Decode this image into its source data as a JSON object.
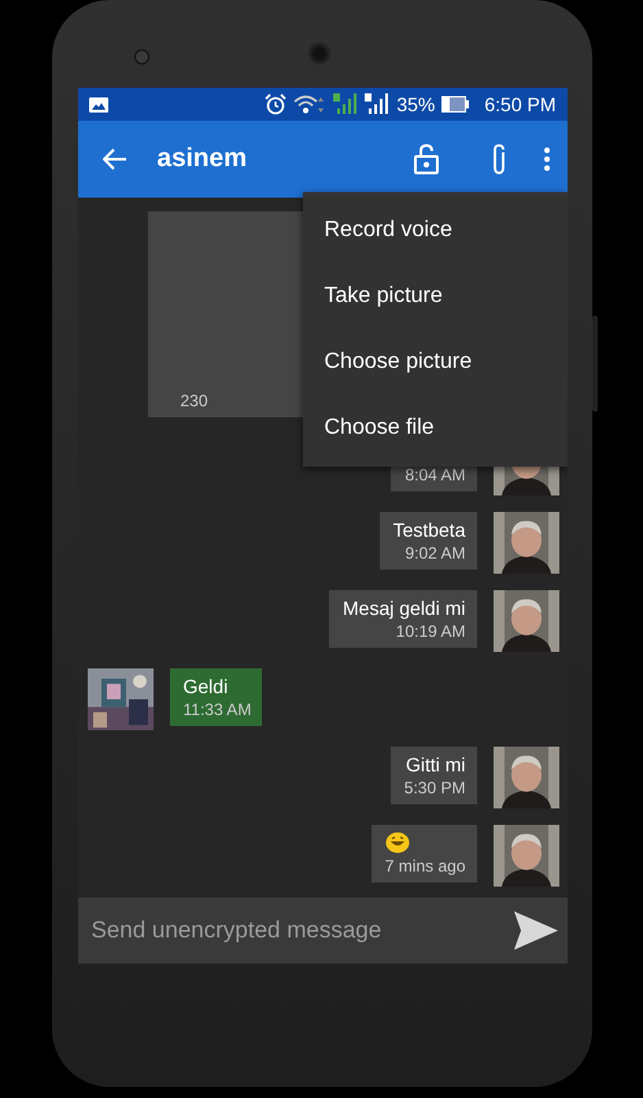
{
  "status_bar": {
    "battery": "35%",
    "time": "6:50 PM"
  },
  "toolbar": {
    "title": "asinem"
  },
  "menu": [
    {
      "label": "Record voice"
    },
    {
      "label": "Take picture"
    },
    {
      "label": "Choose picture"
    },
    {
      "label": "Choose file"
    }
  ],
  "messages": [
    {
      "kind": "media",
      "time": "230"
    },
    {
      "kind": "sent",
      "time": "8:04 AM"
    },
    {
      "kind": "sent",
      "text": "Testbeta",
      "time": "9:02 AM"
    },
    {
      "kind": "sent",
      "text": "Mesaj geldi mi",
      "time": "10:19 AM"
    },
    {
      "kind": "received",
      "text": "Geldi",
      "time": "11:33 AM"
    },
    {
      "kind": "sent",
      "text": "Gitti mi",
      "time": "5:30 PM"
    },
    {
      "kind": "emoji",
      "time": "7 mins ago"
    }
  ],
  "composer": {
    "placeholder": "Send unencrypted message"
  }
}
